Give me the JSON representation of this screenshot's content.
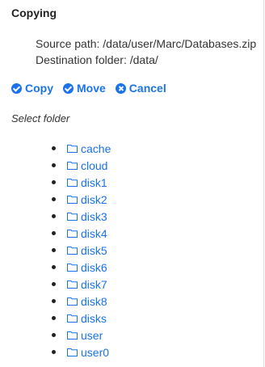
{
  "title": "Copying",
  "info": {
    "source_line": "Source path: /data/user/Marc/Databases.zip",
    "destination_line": "Destination folder: /data/"
  },
  "actions": [
    {
      "label": "Copy",
      "icon": "check-circle-icon"
    },
    {
      "label": "Move",
      "icon": "check-circle-icon"
    },
    {
      "label": "Cancel",
      "icon": "x-circle-icon"
    }
  ],
  "select_label": "Select folder",
  "folders": [
    "cache",
    "cloud",
    "disk1",
    "disk2",
    "disk3",
    "disk4",
    "disk5",
    "disk6",
    "disk7",
    "disk8",
    "disks",
    "user",
    "user0"
  ],
  "colors": {
    "accent": "#1a73e8"
  }
}
